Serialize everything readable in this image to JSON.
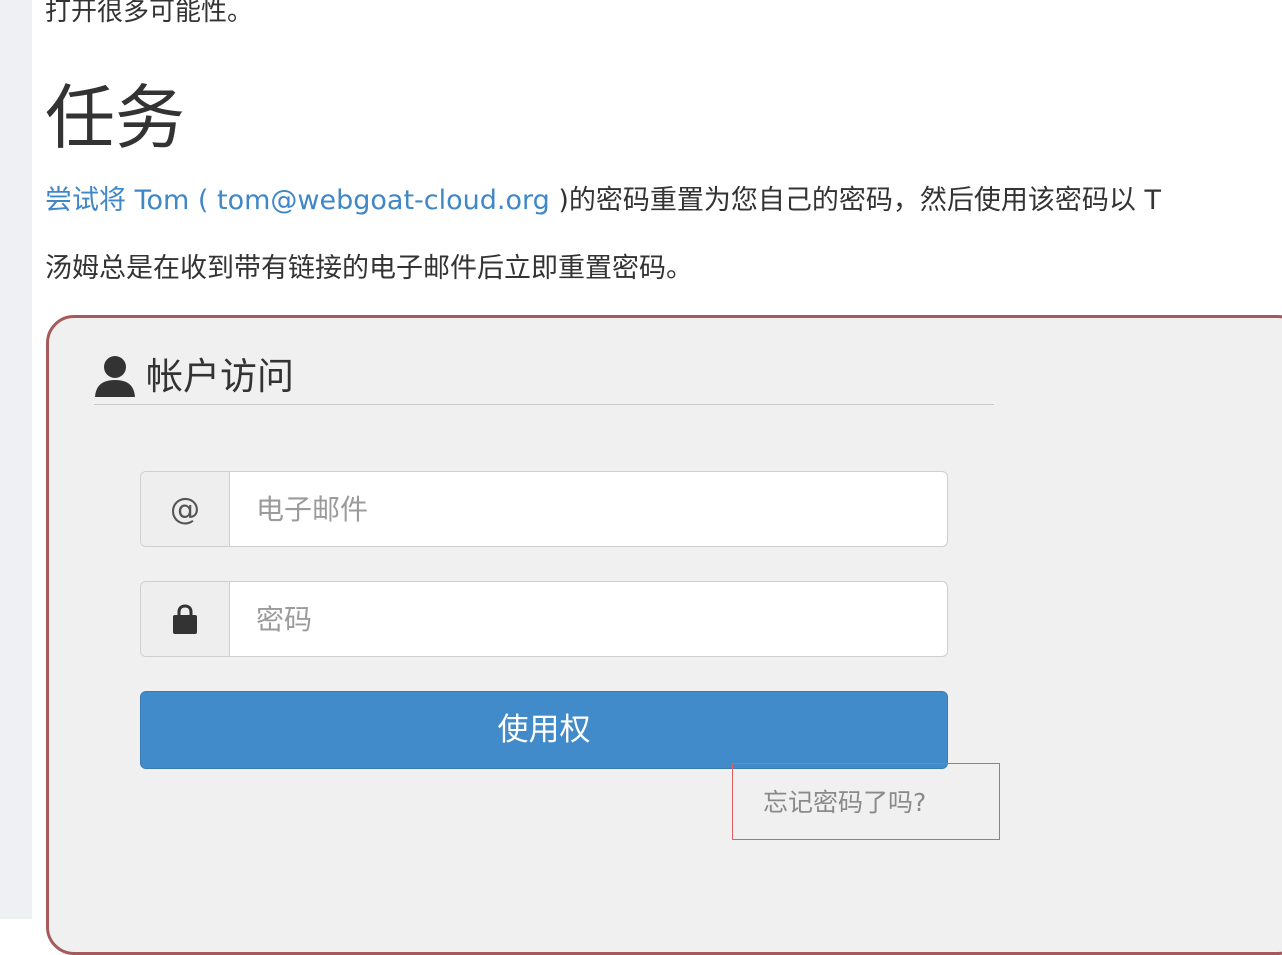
{
  "page": {
    "intro_fragment": "打开很多可能性。",
    "task_heading": "任务",
    "task_link_text": "尝试将 Tom ( tom@webgoat-cloud.org ",
    "task_rest_text": ")的密码重置为您自己的密码，然后使用该密码以 T",
    "note_text": "汤姆总是在收到带有链接的电子邮件后立即重置密码。"
  },
  "login_form": {
    "title": "帐户访问",
    "title_icon": "user-icon",
    "email_addon": "@",
    "email_placeholder": "电子邮件",
    "password_icon": "lock-icon",
    "password_placeholder": "密码",
    "submit_label": "使用权",
    "forgot_password_label": "忘记密码了吗?"
  },
  "colors": {
    "link": "#3f87c7",
    "panel_border": "#a55b5b",
    "panel_background": "#f0f0f0",
    "button": "#428bca",
    "highlight_box": "#e06060"
  }
}
